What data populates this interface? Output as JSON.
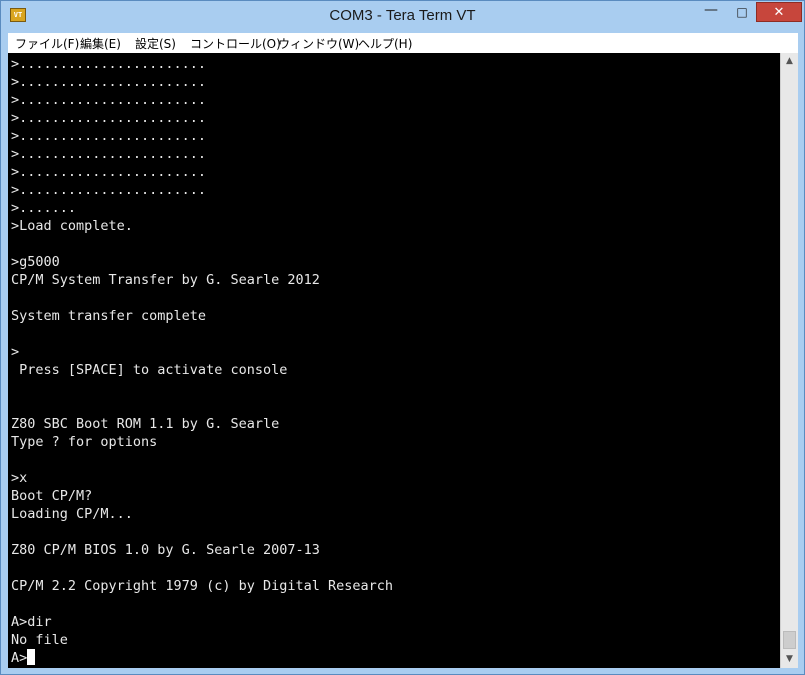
{
  "window": {
    "title": "COM3 - Tera Term VT",
    "icon_text": "VT",
    "controls": {
      "minimize": "—",
      "maximize": "□",
      "close": "✕"
    }
  },
  "menu": [
    {
      "label": "ファイル(F)"
    },
    {
      "label": "編集(E)"
    },
    {
      "label": "設定(S)"
    },
    {
      "label": "コントロール(O)"
    },
    {
      "label": "ウィンドウ(W)"
    },
    {
      "label": "ヘルプ(H)"
    }
  ],
  "terminal": {
    "lines": [
      ">.......................",
      ">.......................",
      ">.......................",
      ">.......................",
      ">.......................",
      ">.......................",
      ">.......................",
      ">.......................",
      ">.......",
      ">Load complete.",
      "",
      ">g5000",
      "CP/M System Transfer by G. Searle 2012",
      "",
      "System transfer complete",
      "",
      ">",
      " Press [SPACE] to activate console",
      "",
      "",
      "Z80 SBC Boot ROM 1.1 by G. Searle",
      "Type ? for options",
      "",
      ">x",
      "Boot CP/M?",
      "Loading CP/M...",
      "",
      "Z80 CP/M BIOS 1.0 by G. Searle 2007-13",
      "",
      "CP/M 2.2 Copyright 1979 (c) by Digital Research",
      "",
      "A>dir",
      "No file"
    ],
    "prompt": "A>"
  },
  "colors": {
    "background": "#000000",
    "text": "#e8e8e8",
    "frame": "#a9cdf0"
  },
  "icons": {
    "scroll_up": "▲",
    "scroll_down": "▼"
  }
}
